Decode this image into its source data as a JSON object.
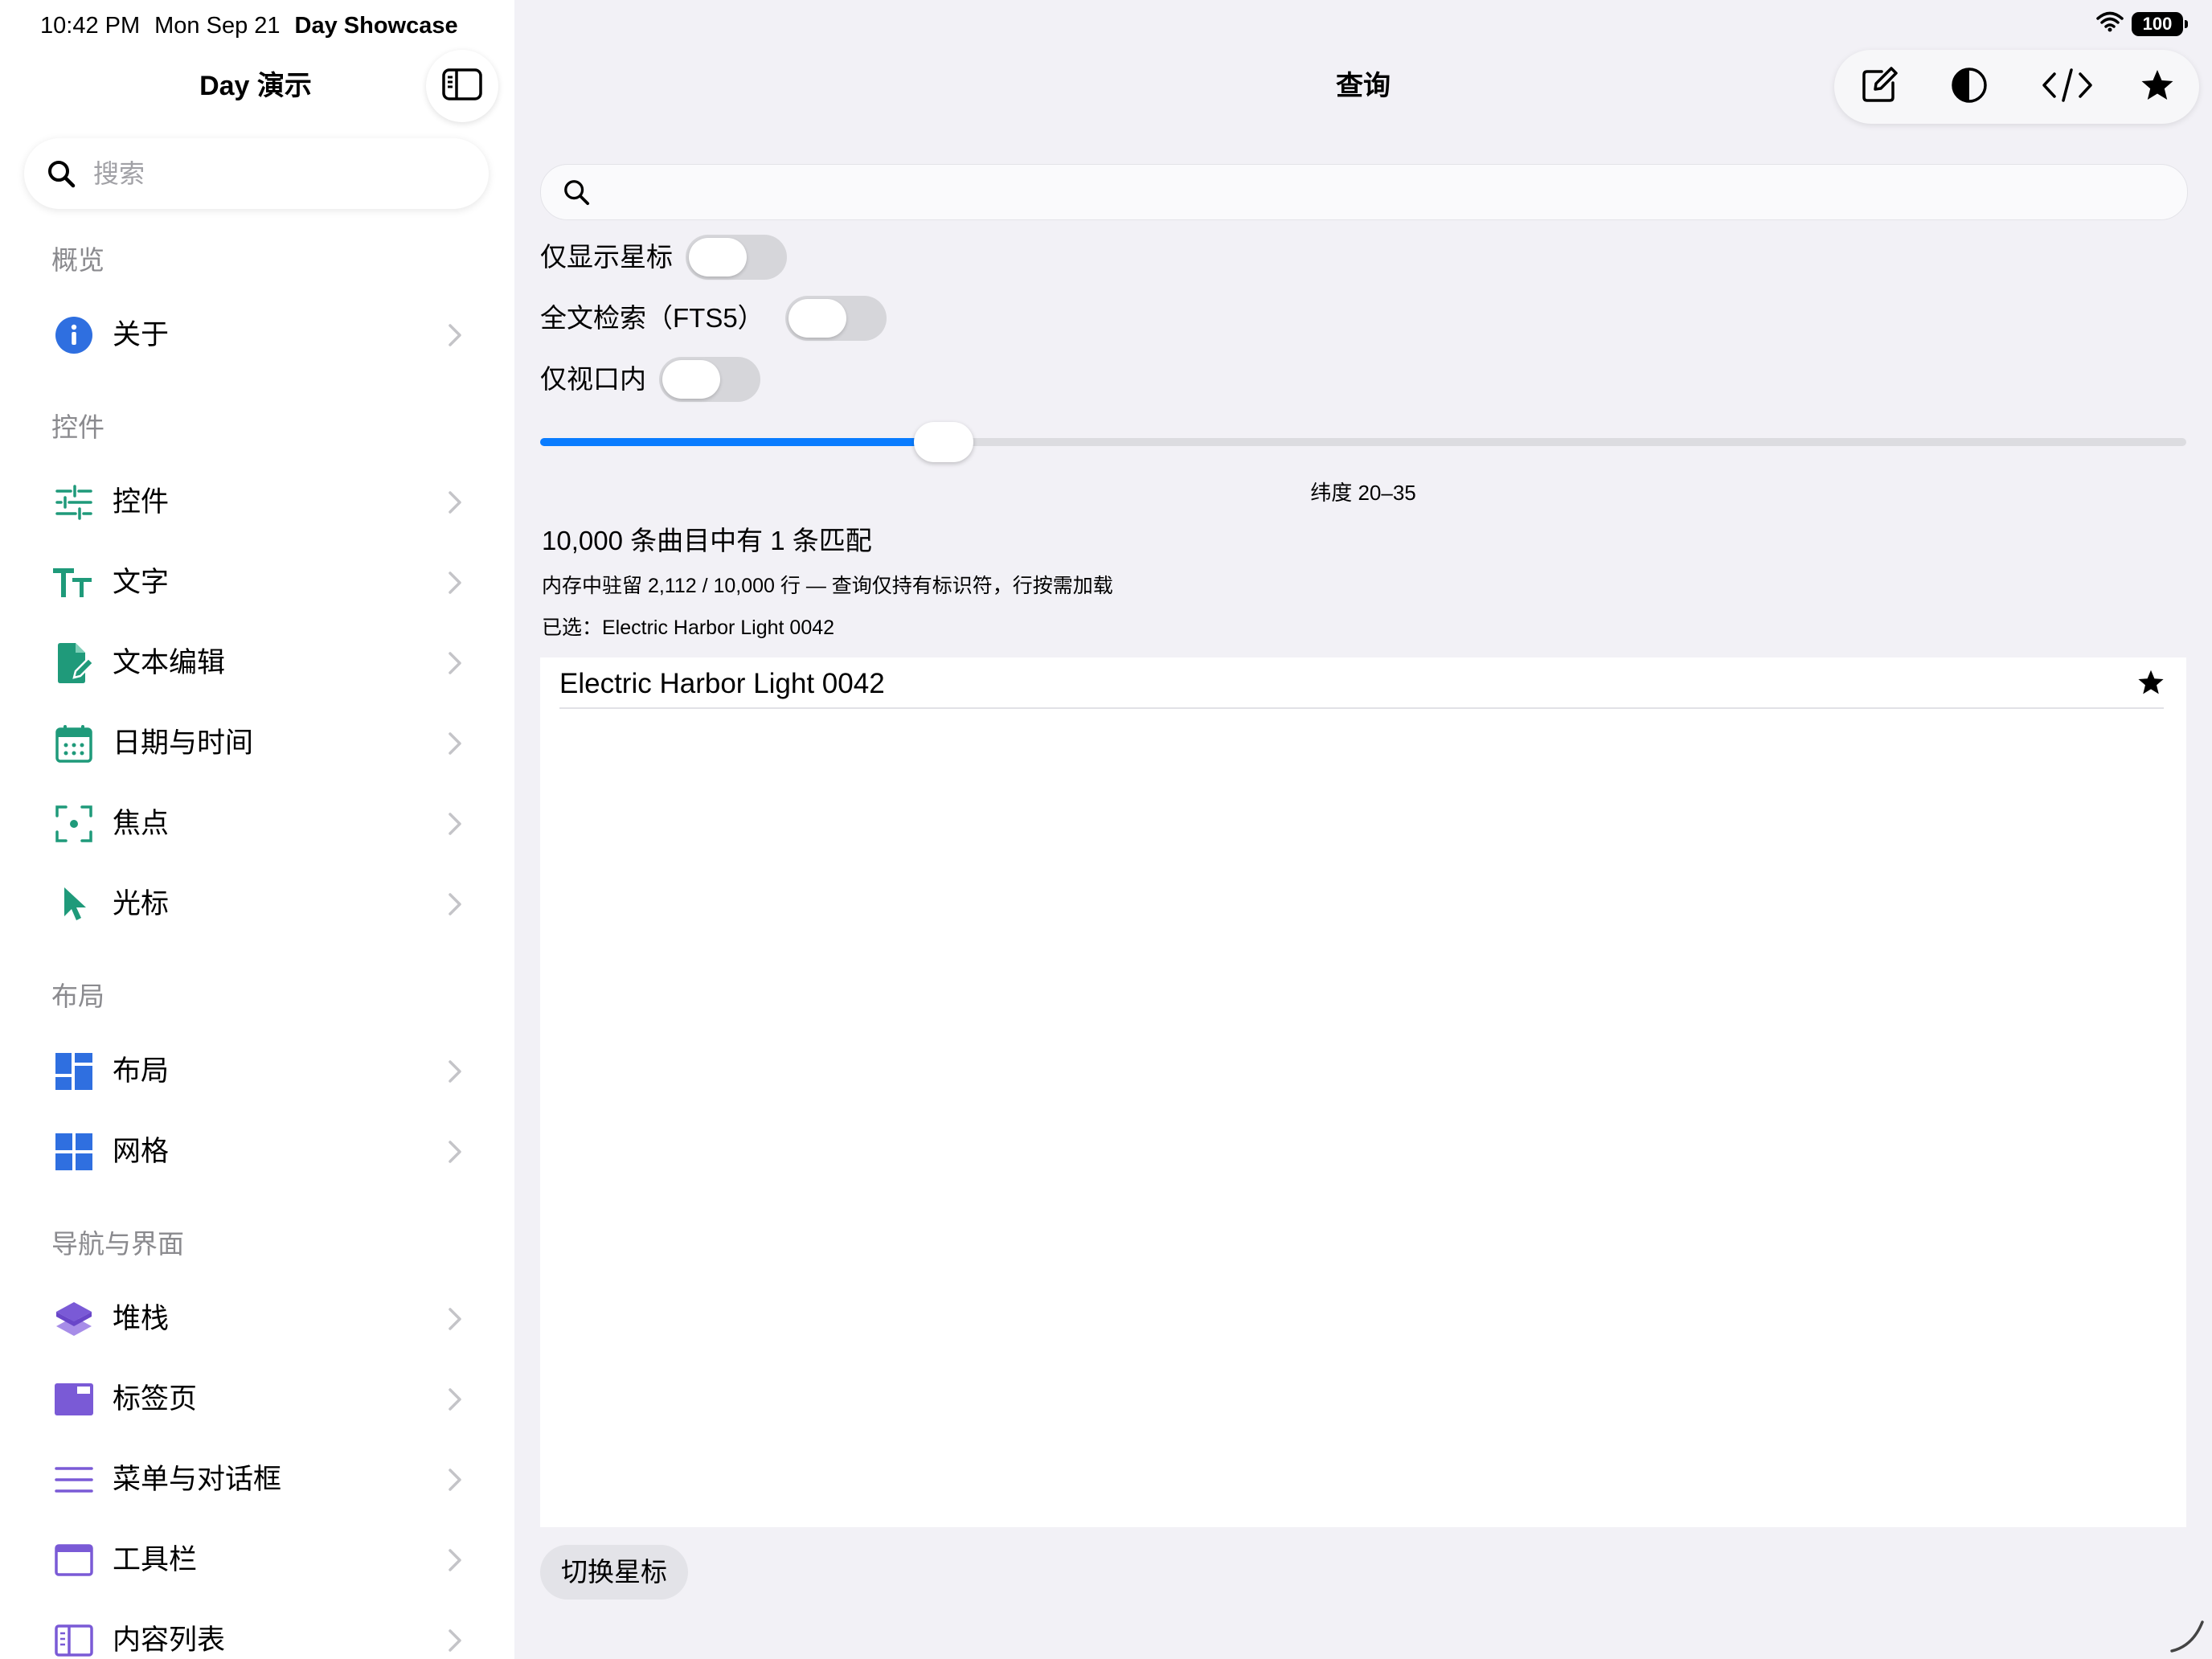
{
  "status_bar": {
    "time": "10:42 PM",
    "date": "Mon Sep 21",
    "app": "Day Showcase",
    "battery": "100"
  },
  "sidebar": {
    "title": "Day 演示",
    "search_placeholder": "搜索",
    "sections": [
      {
        "header": "概览",
        "items": [
          {
            "label": "关于",
            "icon": "info-icon"
          }
        ]
      },
      {
        "header": "控件",
        "items": [
          {
            "label": "控件",
            "icon": "sliders-icon"
          },
          {
            "label": "文字",
            "icon": "text-size-icon"
          },
          {
            "label": "文本编辑",
            "icon": "document-edit-icon"
          },
          {
            "label": "日期与时间",
            "icon": "calendar-icon"
          },
          {
            "label": "焦点",
            "icon": "focus-icon"
          },
          {
            "label": "光标",
            "icon": "cursor-icon"
          }
        ]
      },
      {
        "header": "布局",
        "items": [
          {
            "label": "布局",
            "icon": "layout-icon"
          },
          {
            "label": "网格",
            "icon": "grid-icon"
          }
        ]
      },
      {
        "header": "导航与界面",
        "items": [
          {
            "label": "堆栈",
            "icon": "stack-icon"
          },
          {
            "label": "标签页",
            "icon": "tabs-icon"
          },
          {
            "label": "菜单与对话框",
            "icon": "menu-icon"
          },
          {
            "label": "工具栏",
            "icon": "toolbar-icon"
          },
          {
            "label": "内容列表",
            "icon": "content-list-icon"
          }
        ]
      }
    ]
  },
  "main": {
    "title": "查询",
    "toolbar_icons": [
      "compose-icon",
      "contrast-icon",
      "code-icon",
      "star-icon"
    ],
    "search_value": "",
    "toggles": [
      {
        "label": "仅显示星标",
        "on": false
      },
      {
        "label": "全文检索（FTS5）",
        "on": false
      },
      {
        "label": "仅视口内",
        "on": false
      }
    ],
    "slider": {
      "value_fraction": 0.245,
      "caption": "纬度 20–35"
    },
    "match_summary": "10,000 条曲目中有 1 条匹配",
    "memory_info": "内存中驻留 2,112 / 10,000 行 — 查询仅持有标识符，行按需加载",
    "selected_info": "已选：Electric Harbor Light 0042",
    "results": [
      {
        "title": "Electric Harbor Light 0042",
        "starred": true
      }
    ],
    "toggle_star_button": "切换星标"
  },
  "colors": {
    "accent": "#0a7cff",
    "green_icons": "#1f9a7a",
    "blue_icons": "#2f6fe0",
    "purple_icons": "#7a5ad6",
    "sidebar_bg": "#ffffff",
    "main_bg": "#f2f1f6"
  }
}
